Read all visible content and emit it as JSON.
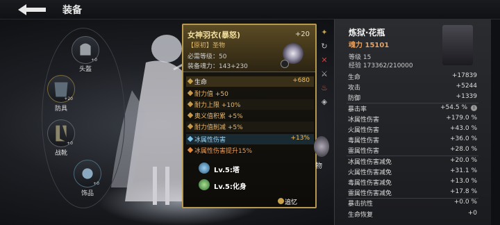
{
  "header": {
    "title": "装备"
  },
  "slots": [
    {
      "label": "头盔",
      "level": "+0"
    },
    {
      "label": "防具",
      "level": "+20"
    },
    {
      "label": "战靴",
      "level": "+0"
    },
    {
      "label": "饰品",
      "level": "+0"
    }
  ],
  "tooltip": {
    "name": "女神羽衣(暴怒)",
    "enhance": "+20",
    "quality": "【原初】圣物",
    "req_level": "必需等级：50",
    "soul": "装备魂力：143+230",
    "stats": [
      {
        "label": "生命",
        "value": "+680",
        "kind": "main"
      },
      {
        "label": "耐力值 +50",
        "value": "",
        "kind": "sub"
      },
      {
        "label": "耐力上限 +10%",
        "value": "",
        "kind": "sub"
      },
      {
        "label": "奥义值积累 +5%",
        "value": "",
        "kind": "sub"
      },
      {
        "label": "耐力值削减 +5%",
        "value": "",
        "kind": "sub"
      },
      {
        "label": "冰属性伤害",
        "value": "+13%",
        "kind": "ice"
      },
      {
        "label": "冰属性伤害提升15%",
        "value": "",
        "kind": "ice2"
      }
    ],
    "skills": [
      {
        "text": "Lv.5:塔"
      },
      {
        "text": "Lv.5:化身"
      }
    ],
    "recall": "追忆"
  },
  "side_label": "物",
  "panel": {
    "name": "炼狱·花瓶",
    "soul_power": "魂力 15101",
    "level": "等级 15",
    "exp": "经验 173362/210000",
    "stats": [
      {
        "label": "生命",
        "value": "+17839"
      },
      {
        "label": "攻击",
        "value": "+5244"
      },
      {
        "label": "防御",
        "value": "+1339"
      },
      {
        "label": "暴击率",
        "value": "+54.5 %"
      },
      {
        "label": "冰属性伤害",
        "value": "+179.0 %"
      },
      {
        "label": "火属性伤害",
        "value": "+43.0 %"
      },
      {
        "label": "毒属性伤害",
        "value": "+36.0 %"
      },
      {
        "label": "雷属性伤害",
        "value": "+28.0 %"
      },
      {
        "label": "冰属性伤害减免",
        "value": "+20.0 %"
      },
      {
        "label": "火属性伤害减免",
        "value": "+31.1 %"
      },
      {
        "label": "毒属性伤害减免",
        "value": "+13.0 %"
      },
      {
        "label": "雷属性伤害减免",
        "value": "+17.8 %"
      },
      {
        "label": "暴击抗性",
        "value": "+0.0 %"
      },
      {
        "label": "生命恢复",
        "value": "+0"
      }
    ]
  }
}
